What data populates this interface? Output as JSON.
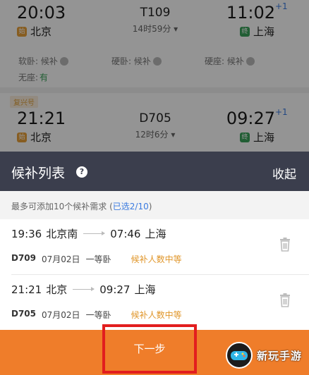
{
  "trains": [
    {
      "badge": "",
      "dep_time": "20:03",
      "dep_station": "北京",
      "code": "T109",
      "duration": "14时59分",
      "arr_time": "11:02",
      "arr_day_plus": "+1",
      "arr_station": "上海",
      "seats": [
        {
          "label": "软卧: 候补"
        },
        {
          "label": "硬卧: 候补"
        },
        {
          "label": "硬座: 候补"
        }
      ],
      "no_seat_label": "无座:",
      "no_seat_status": "有"
    },
    {
      "badge": "复兴号",
      "dep_time": "21:21",
      "dep_station": "北京",
      "code": "D705",
      "duration": "12时6分",
      "arr_time": "09:27",
      "arr_day_plus": "+1",
      "arr_station": "上海"
    }
  ],
  "panel": {
    "title": "候补列表",
    "help_icon": "?",
    "collapse_label": "收起",
    "limit_text": "最多可添加10个候补需求 (",
    "selected_text": "已选2/10",
    "limit_close": ")"
  },
  "waitlist": [
    {
      "dep_time": "19:36",
      "dep_station": "北京南",
      "arr_time": "07:46",
      "arr_station": "上海",
      "code": "D709",
      "date": "07月02日",
      "class": "一等卧",
      "hint": "候补人数中等"
    },
    {
      "dep_time": "21:21",
      "dep_station": "北京",
      "arr_time": "09:27",
      "arr_station": "上海",
      "code": "D705",
      "date": "07月02日",
      "class": "一等卧",
      "hint": "候补人数中等"
    }
  ],
  "next_button_label": "下一步",
  "watermark_text": "新玩手游",
  "colors": {
    "panel_header": "#3b3e4d",
    "accent_orange": "#ef7d2a",
    "link_blue": "#3b7be0",
    "hint_orange": "#e0962a",
    "highlight_red": "#e21e1e"
  }
}
